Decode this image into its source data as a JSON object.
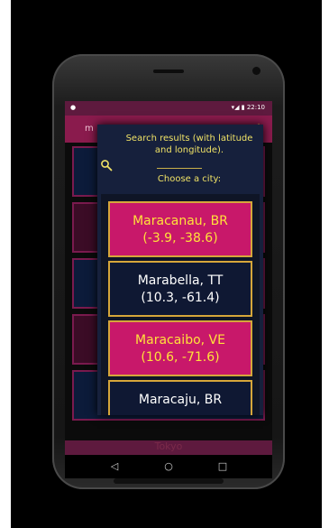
{
  "statusbar": {
    "left": "●",
    "right": "▾◢ ▮ 22:10"
  },
  "appbar": {
    "menu_hint": "m",
    "overflow": "⋮"
  },
  "dialog": {
    "title": "Search results (with latitude and longitude).",
    "subtitle": "Choose a city:"
  },
  "cities": [
    {
      "name": "Maracanau, BR",
      "coords": "(-3.9, -38.6)"
    },
    {
      "name": "Marabella, TT",
      "coords": "(10.3, -61.4)"
    },
    {
      "name": "Maracaibo, VE",
      "coords": "(10.6, -71.6)"
    },
    {
      "name": "Maracaju, BR",
      "coords": ""
    }
  ],
  "background_text": "Tokyo",
  "navbar": {
    "back": "◁",
    "home": "○",
    "recents": "□"
  },
  "colors": {
    "accent_yellow": "#f0e266",
    "pink": "#c8186a",
    "navy": "#0f1833",
    "gold_border": "#d6a63a",
    "appbar": "#8a1b4d"
  }
}
